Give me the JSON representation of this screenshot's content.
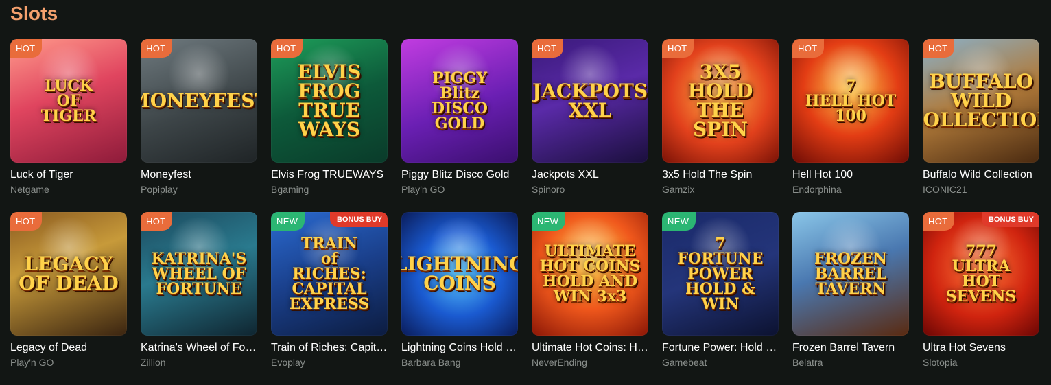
{
  "section": {
    "title": "Slots"
  },
  "games": [
    {
      "name": "Luck of Tiger",
      "provider": "Netgame",
      "badge": "HOT",
      "bonus": "",
      "art": "LUCK\nOF\nTIGER",
      "bg": "linear-gradient(160deg,#ff9a8b 0%,#e0455f 45%,#8e1b3a 100%)"
    },
    {
      "name": "Moneyfest",
      "provider": "Popiplay",
      "badge": "HOT",
      "bonus": "",
      "art": "MONEYFEST",
      "bg": "linear-gradient(160deg,#6f7a7f 0%,#3d4548 55%,#1f2426 100%)"
    },
    {
      "name": "Elvis Frog TRUEWAYS",
      "provider": "Bgaming",
      "badge": "HOT",
      "bonus": "",
      "art": "ELVIS FROG\nTRUE WAYS",
      "bg": "linear-gradient(160deg,#1e9e5a 0%,#0d5a3a 50%,#0a3b2a 100%)"
    },
    {
      "name": "Piggy Blitz Disco Gold",
      "provider": "Play'n GO",
      "badge": "",
      "bonus": "",
      "art": "PIGGY\nBlitz\nDISCO GOLD",
      "bg": "linear-gradient(160deg,#c13ce0 0%,#6a1fb3 55%,#3a0f6e 100%)"
    },
    {
      "name": "Jackpots XXL",
      "provider": "Spinoro",
      "badge": "HOT",
      "bonus": "",
      "art": "JACKPOTS\nXXL",
      "bg": "linear-gradient(160deg,#3a1a7a 0%,#5a2aa8 45%,#1a0f3c 100%)"
    },
    {
      "name": "3x5 Hold The Spin",
      "provider": "Gamzix",
      "badge": "HOT",
      "bonus": "",
      "art": "3X5\nHOLD THE SPIN",
      "bg": "radial-gradient(circle at 50% 45%,#ffb347 0%,#e2411c 55%,#7a1206 100%)"
    },
    {
      "name": "Hell Hot 100",
      "provider": "Endorphina",
      "badge": "HOT",
      "bonus": "",
      "art": "7\nHELL HOT\n100",
      "bg": "radial-gradient(circle at 50% 40%,#ffcc4d 0%,#e33d14 50%,#6e0c05 100%)"
    },
    {
      "name": "Buffalo Wild Collection",
      "provider": "ICONIC21",
      "badge": "HOT",
      "bonus": "",
      "art": "BUFFALO\nWILD COLLECTION",
      "bg": "linear-gradient(160deg,#8ab0c8 0%,#b07a3a 50%,#4a2a10 100%)"
    },
    {
      "name": "Legacy of Dead",
      "provider": "Play'n GO",
      "badge": "HOT",
      "bonus": "",
      "art": "LEGACY\nOF DEAD",
      "bg": "linear-gradient(160deg,#8a5a20 0%,#c79a3a 40%,#3a2410 100%)"
    },
    {
      "name": "Katrina's Wheel of Fortune",
      "provider": "Zillion",
      "badge": "HOT",
      "bonus": "",
      "art": "KATRINA'S\nWHEEL OF\nFORTUNE",
      "bg": "linear-gradient(160deg,#1c4a5e 0%,#2a7a8e 45%,#0f2530 100%)"
    },
    {
      "name": "Train of Riches: Capital Express",
      "provider": "Evoplay",
      "badge": "NEW",
      "bonus": "BONUS BUY",
      "art": "TRAIN\nof\nRICHES:\nCAPITAL EXPRESS",
      "bg": "linear-gradient(160deg,#2a6ad0 0%,#1a3f8a 50%,#0c1c40 100%)"
    },
    {
      "name": "Lightning Coins Hold and Win",
      "provider": "Barbara Bang",
      "badge": "",
      "bonus": "",
      "art": "LIGHTNING\nCOINS",
      "bg": "radial-gradient(circle at 50% 50%,#5ac8ff 0%,#1a5ad0 50%,#0a1c5a 100%)"
    },
    {
      "name": "Ultimate Hot Coins: Hold and Win",
      "provider": "NeverEnding",
      "badge": "NEW",
      "bonus": "",
      "art": "ULTIMATE\nHOT COINS\nHOLD AND WIN 3x3",
      "bg": "radial-gradient(circle at 50% 40%,#ffd34d 0%,#f0581c 50%,#8a1606 100%)"
    },
    {
      "name": "Fortune Power: Hold and Win",
      "provider": "Gamebeat",
      "badge": "NEW",
      "bonus": "",
      "art": "7\nFORTUNE\nPOWER HOLD & WIN",
      "bg": "linear-gradient(160deg,#1a2a6a 0%,#24357a 50%,#0c1230 100%)"
    },
    {
      "name": "Frozen Barrel Tavern",
      "provider": "Belatra",
      "badge": "",
      "bonus": "",
      "art": "FROZEN\nBARREL\nTAVERN",
      "bg": "linear-gradient(160deg,#8ac6e8 0%,#4a78b0 45%,#5a2a10 100%)"
    },
    {
      "name": "Ultra Hot Sevens",
      "provider": "Slotopia",
      "badge": "HOT",
      "bonus": "BONUS BUY",
      "art": "777\nULTRA\nHOT\nSEVENS",
      "bg": "radial-gradient(circle at 50% 45%,#ff7a3a 0%,#d0240f 55%,#6a0604 100%)"
    }
  ]
}
